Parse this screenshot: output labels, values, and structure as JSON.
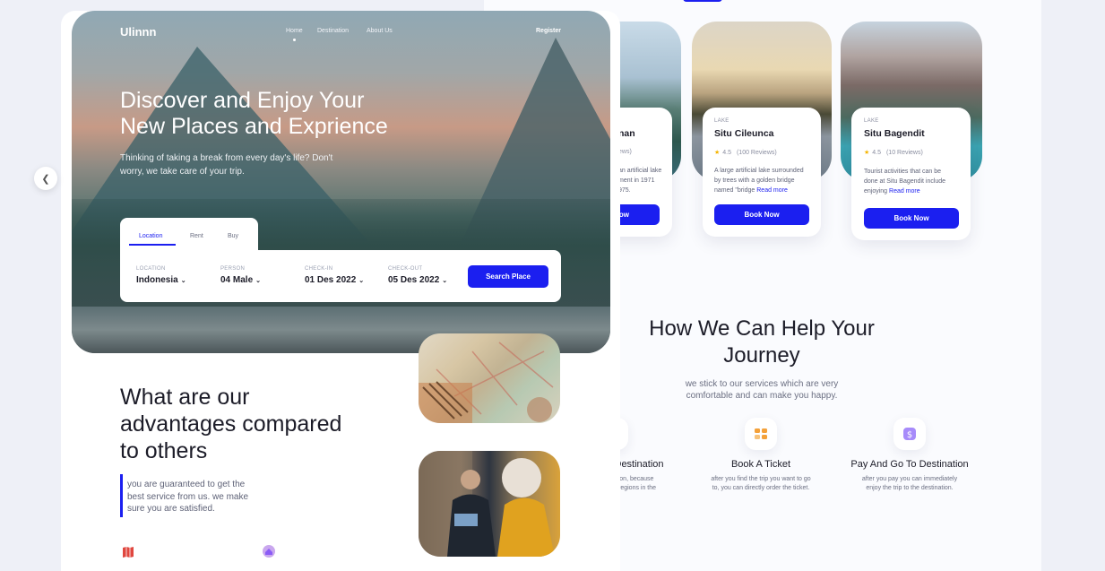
{
  "nav": {
    "logo": "Ulinnn",
    "items": [
      "Home",
      "Destination",
      "About Us"
    ],
    "register": "Register"
  },
  "hero": {
    "title_line1": "Discover and Enjoy Your",
    "title_line2": "New Places and Exprience",
    "subtitle_line1": "Thinking of taking a break from every day's life? Don't",
    "subtitle_line2": "worry, we take care  of your trip."
  },
  "search": {
    "tabs": [
      "Location",
      "Rent",
      "Buy"
    ],
    "fields": [
      {
        "label": "LOCATION",
        "value": "Indonesia"
      },
      {
        "label": "PERSON",
        "value": "04 Male"
      },
      {
        "label": "CHECK-IN",
        "value": "01 Des 2022"
      },
      {
        "label": "CHECK-OUT",
        "value": "05 Des 2022"
      }
    ],
    "button": "Search Place"
  },
  "advantages": {
    "title_line1": "What are our",
    "title_line2": "advantages compared",
    "title_line3": "to others",
    "text_line1": "you are guaranteed to get the",
    "text_line2": "best service from us. we make",
    "text_line3": "sure you are satisfied."
  },
  "destinations": [
    {
      "title": "nan",
      "reviews": "ews)",
      "desc_line1": "an artificial lake",
      "desc_line2": "ment in 1971",
      "desc_line3": "975.",
      "button": "ow"
    },
    {
      "category": "LAKE",
      "title": "Situ Cileunca",
      "rating": "4.5",
      "reviews": "(100 Reviews)",
      "desc_line1": "A large artificial lake surrounded",
      "desc_line2": "by trees with a golden bridge",
      "desc_line3": "named \"bridge",
      "more": "Read more",
      "button": "Book Now"
    },
    {
      "category": "LAKE",
      "title": "Situ Bagendit",
      "rating": "4.5",
      "reviews": "(10 Reviews)",
      "desc_line1": "Tourist activities that can be",
      "desc_line2": "done at Situ Bagendit include",
      "desc_line3": "enjoying",
      "more": "Read more",
      "button": "Book Now"
    }
  ],
  "help": {
    "title_line1": "How We Can Help Your",
    "title_line2": "Journey",
    "sub_line1": "we stick to our services which are very",
    "sub_line2": "comfortable and can make you happy.",
    "services": [
      {
        "title": "l Destination",
        "desc_line1": "nation, because",
        "desc_line2": "regions in the",
        "icon": "map-pin-icon"
      },
      {
        "title": "Book A Ticket",
        "desc_line1": "after you find the trip you want to go",
        "desc_line2": "to, you can directly order the ticket.",
        "icon": "ticket-icon"
      },
      {
        "title": "Pay And Go To Destination",
        "desc_line1": "after you pay you can immediately",
        "desc_line2": "enjoy the trip to the destination.",
        "icon": "dollar-icon"
      }
    ]
  },
  "colors": {
    "accent": "#1b1ff0",
    "star": "#f5b400",
    "background": "#eef0f7"
  }
}
